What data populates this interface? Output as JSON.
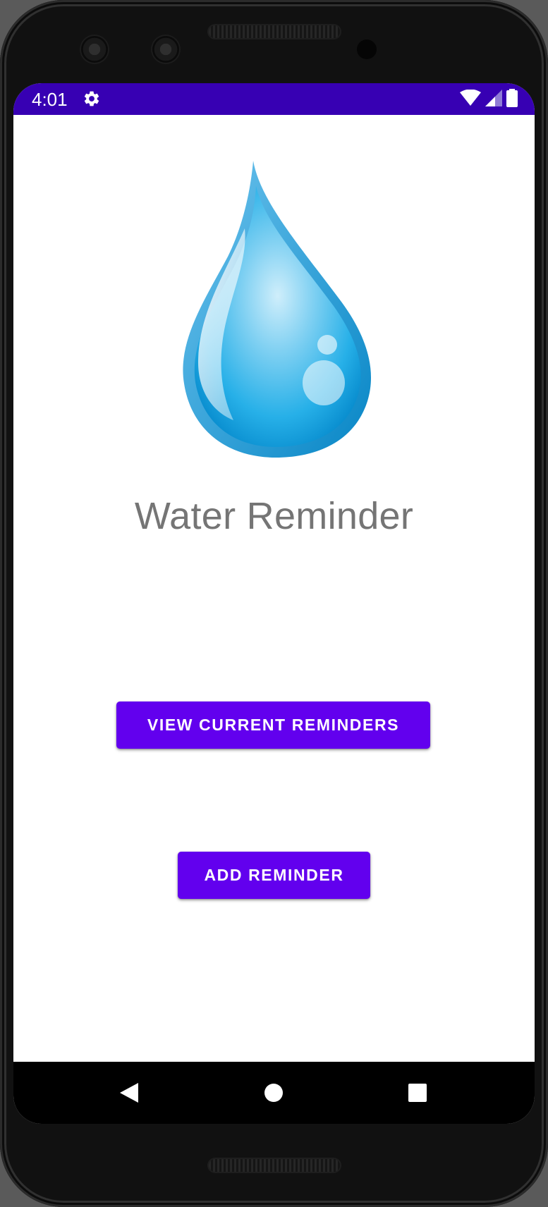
{
  "status_bar": {
    "time": "4:01",
    "background_color": "#3700b3",
    "icons": [
      "gear-icon",
      "wifi-icon",
      "cellular-signal-icon",
      "battery-icon"
    ]
  },
  "app": {
    "title": "Water Reminder",
    "logo": "water-drop-icon",
    "accent_color": "#6200ee"
  },
  "buttons": {
    "view_current_reminders": "VIEW CURRENT REMINDERS",
    "add_reminder": "ADD REMINDER"
  },
  "nav_bar": {
    "icons": [
      "back-icon",
      "home-icon",
      "recents-icon"
    ]
  }
}
